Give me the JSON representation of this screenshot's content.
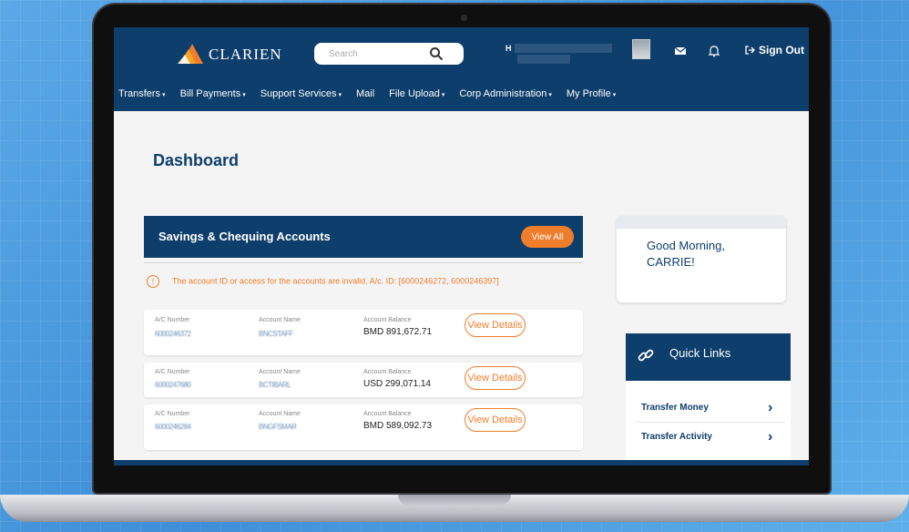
{
  "brand": {
    "name": "CLARIEN",
    "primary_color": "#0d3e6c",
    "accent_color": "#f07d2b"
  },
  "header": {
    "search_placeholder": "Search",
    "user_initial": "H",
    "sign_out_label": "Sign Out",
    "icons": [
      "search-icon",
      "avatar",
      "mail-icon",
      "bell-icon",
      "sign-out-icon"
    ]
  },
  "nav": [
    {
      "label": "Transfers",
      "caret": "▾"
    },
    {
      "label": "Bill Payments",
      "caret": "▾"
    },
    {
      "label": "Support Services",
      "caret": "▾"
    },
    {
      "label": "Mail",
      "caret": ""
    },
    {
      "label": "File Upload",
      "caret": "▾"
    },
    {
      "label": "Corp Administration",
      "caret": "▾"
    },
    {
      "label": "My Profile",
      "caret": "▾"
    }
  ],
  "page_title": "Dashboard",
  "accounts_card": {
    "title": "Savings & Chequing Accounts",
    "view_all_label": "View All",
    "warning": "The account ID or access for the accounts are invalid. A/c. ID: [6000246272, 6000246397]",
    "col_labels": {
      "number": "A/C Number",
      "name": "Account Name",
      "balance": "Account Balance"
    },
    "view_details_label": "View Details",
    "rows": [
      {
        "number": "6000246372",
        "name": "BNCSTAFF",
        "balance": "BMD 891,672.71"
      },
      {
        "number": "6000247680",
        "name": "BCTIBARL",
        "balance": "USD 299,071.14"
      },
      {
        "number": "6000246284",
        "name": "BNGFSMAR",
        "balance": "BMD 589,092.73"
      }
    ]
  },
  "greeting": {
    "text": "Good Morning, CARRIE!"
  },
  "quick_links": {
    "title": "Quick Links",
    "items": [
      {
        "label": "Transfer Money",
        "chevron": "›"
      },
      {
        "label": "Transfer Activity",
        "chevron": "›"
      }
    ]
  }
}
